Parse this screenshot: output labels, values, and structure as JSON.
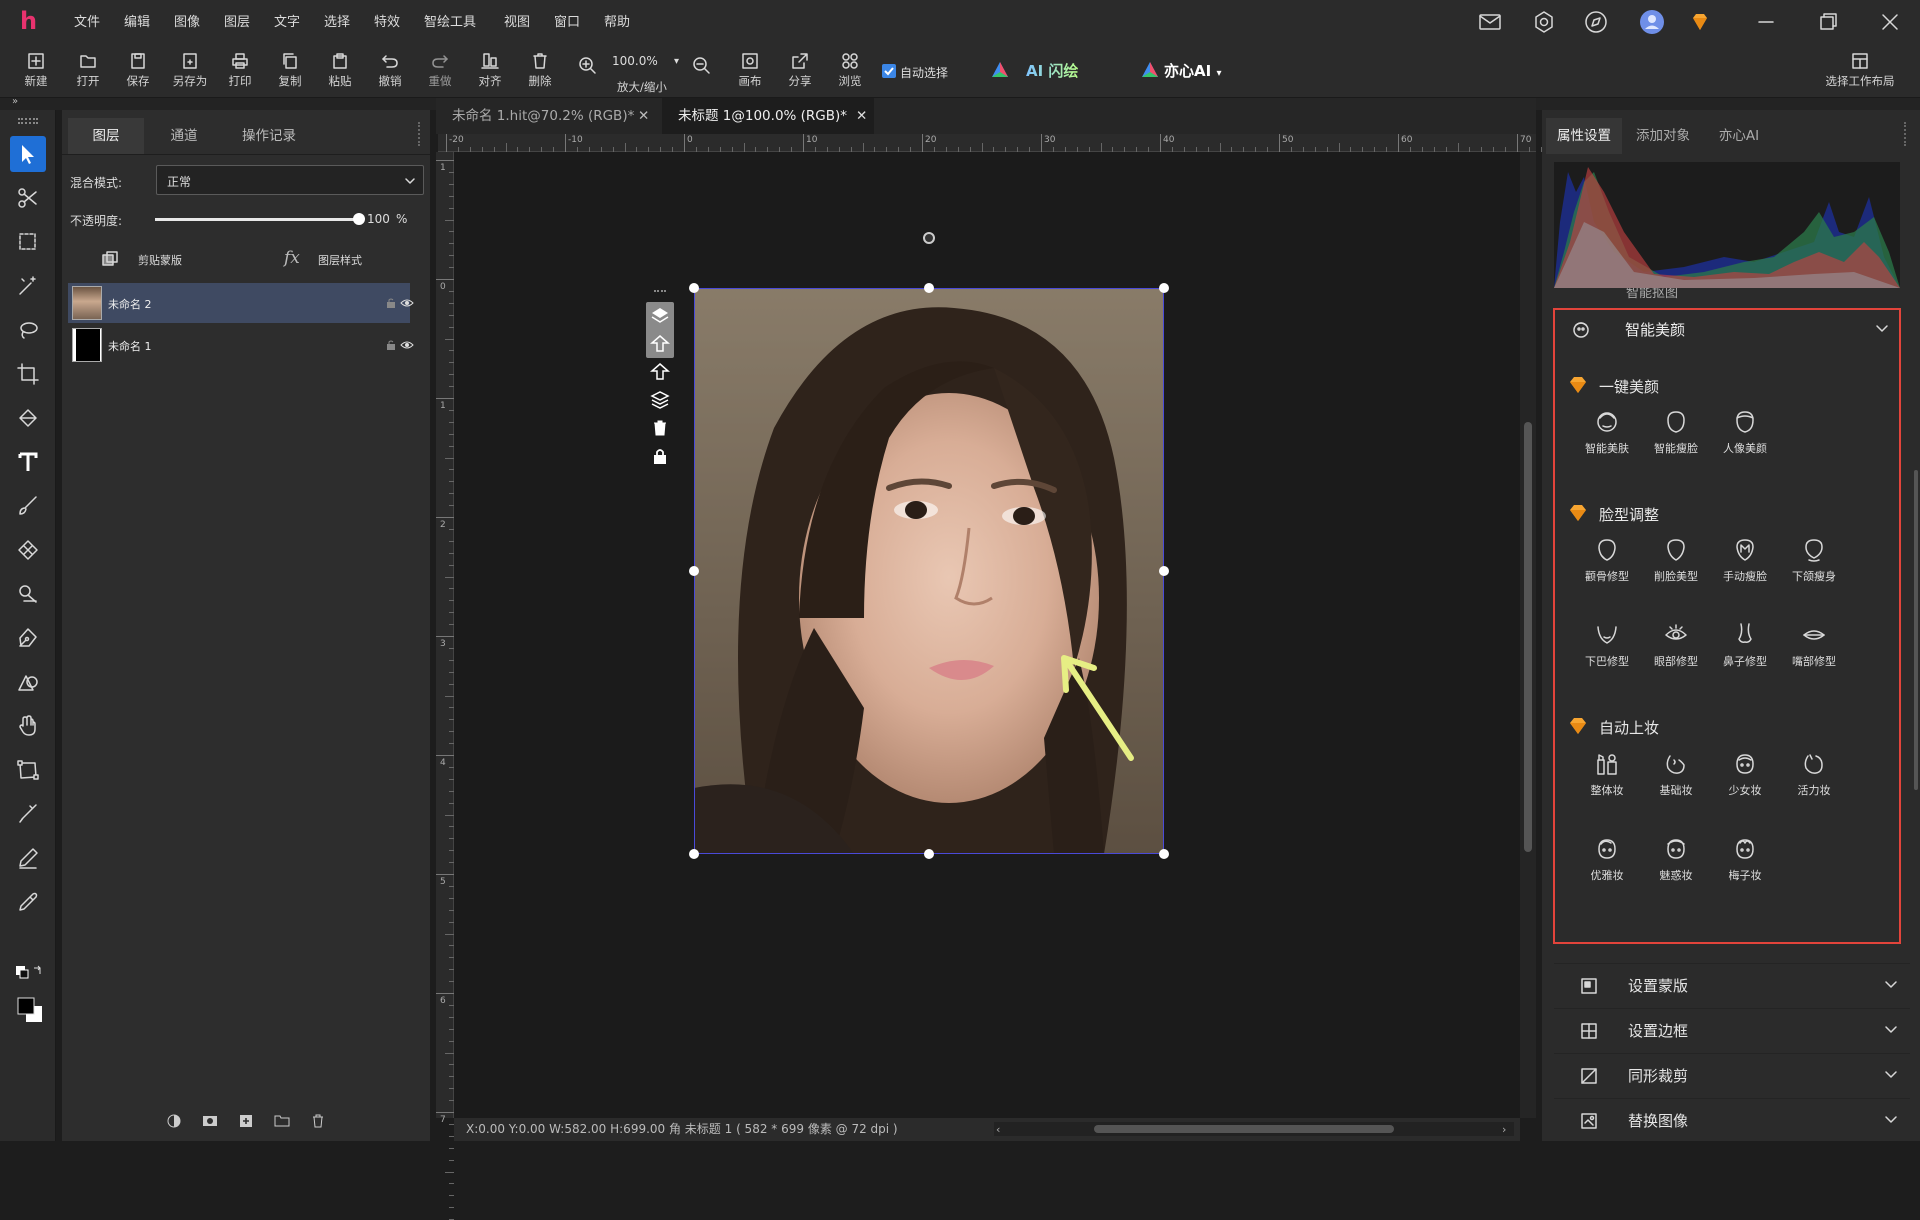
{
  "app": {
    "logo": "h",
    "menu": [
      "文件",
      "编辑",
      "图像",
      "图层",
      "文字",
      "选择",
      "特效",
      "智绘工具",
      "视图",
      "窗口",
      "帮助"
    ]
  },
  "toolbar": {
    "buttons": [
      {
        "label": "新建",
        "icon": "new-icon"
      },
      {
        "label": "打开",
        "icon": "open-icon"
      },
      {
        "label": "保存",
        "icon": "save-icon"
      },
      {
        "label": "另存为",
        "icon": "save-as-icon"
      },
      {
        "label": "打印",
        "icon": "print-icon"
      },
      {
        "label": "复制",
        "icon": "copy-icon"
      },
      {
        "label": "粘贴",
        "icon": "paste-icon"
      },
      {
        "label": "撤销",
        "icon": "undo-icon"
      },
      {
        "label": "重做",
        "icon": "redo-icon"
      },
      {
        "label": "对齐",
        "icon": "align-icon"
      },
      {
        "label": "删除",
        "icon": "delete-icon"
      }
    ],
    "zoom_value": "100.0%",
    "zoom_label": "放大/缩小",
    "canvas_label": "画布",
    "share_label": "分享",
    "browse_label": "浏览",
    "auto_select_label": "自动选择",
    "auto_select_checked": true,
    "ai_draw_label": "AI 闪绘",
    "yixin_ai_label": "亦心AI",
    "workspace_label": "选择工作布局"
  },
  "layers_panel": {
    "tabs": [
      "图层",
      "通道",
      "操作记录"
    ],
    "blend_mode_label": "混合模式:",
    "blend_mode_value": "正常",
    "opacity_label": "不透明度:",
    "opacity_value": "100",
    "opacity_unit": "%",
    "opacity_fraction": 1.0,
    "clip_mask_label": "剪贴蒙版",
    "layer_style_label": "图层样式",
    "layers": [
      {
        "name": "未命名 2",
        "selected": true
      },
      {
        "name": "未命名 1",
        "selected": false
      }
    ]
  },
  "documents": {
    "tabs": [
      {
        "title": "未命名 1.hit@70.2% (RGB)*",
        "active": false
      },
      {
        "title": "未标题 1@100.0% (RGB)*",
        "active": true
      }
    ]
  },
  "rulers": {
    "h_ticks": [
      "-20",
      "-10",
      "0",
      "10",
      "20",
      "30",
      "40",
      "50",
      "60",
      "70"
    ],
    "v_ticks": [
      "1",
      "0",
      "1",
      "2",
      "3",
      "4",
      "5",
      "6",
      "7"
    ]
  },
  "status": {
    "text": "X:0.00 Y:0.00 W:582.00 H:699.00 角    未标题 1 ( 582 * 699 像素 @ 72 dpi )"
  },
  "right_panel": {
    "tabs": [
      "属性设置",
      "添加对象",
      "亦心AI"
    ],
    "partial_label": "智能抠图",
    "beauty": {
      "title": "智能美颜",
      "sections": [
        {
          "title": "一键美颜",
          "items": [
            {
              "label": "智能美肤",
              "icon": "face-skin-icon"
            },
            {
              "label": "智能瘦脸",
              "icon": "face-slim-icon"
            },
            {
              "label": "人像美颜",
              "icon": "portrait-beauty-icon"
            }
          ]
        },
        {
          "title": "脸型调整",
          "items": [
            {
              "label": "颧骨修型",
              "icon": "cheekbone-icon"
            },
            {
              "label": "削脸美型",
              "icon": "face-contour-icon"
            },
            {
              "label": "手动瘦脸",
              "icon": "manual-slim-icon"
            },
            {
              "label": "下颌瘦身",
              "icon": "jaw-slim-icon"
            },
            {
              "label": "下巴修型",
              "icon": "chin-icon"
            },
            {
              "label": "眼部修型",
              "icon": "eye-shape-icon"
            },
            {
              "label": "鼻子修型",
              "icon": "nose-shape-icon"
            },
            {
              "label": "嘴部修型",
              "icon": "mouth-shape-icon"
            }
          ]
        },
        {
          "title": "自动上妆",
          "items": [
            {
              "label": "整体妆",
              "icon": "full-makeup-icon"
            },
            {
              "label": "基础妆",
              "icon": "basic-makeup-icon"
            },
            {
              "label": "少女妆",
              "icon": "girl-makeup-icon"
            },
            {
              "label": "活力妆",
              "icon": "vivid-makeup-icon"
            },
            {
              "label": "优雅妆",
              "icon": "elegant-makeup-icon"
            },
            {
              "label": "魅惑妆",
              "icon": "charm-makeup-icon"
            },
            {
              "label": "梅子妆",
              "icon": "plum-makeup-icon"
            }
          ]
        }
      ]
    },
    "accordions": [
      {
        "label": "设置蒙版",
        "icon": "mask-icon"
      },
      {
        "label": "设置边框",
        "icon": "border-icon"
      },
      {
        "label": "同形裁剪",
        "icon": "crop-shape-icon"
      },
      {
        "label": "替换图像",
        "icon": "replace-image-icon"
      }
    ]
  },
  "colors": {
    "accent": "#1f6fd6",
    "highlight_border": "#e2443b",
    "premium_gem": "#f7a531",
    "selected_layer": "#3f4a62",
    "annotation_arrow": "#e6ee84"
  }
}
